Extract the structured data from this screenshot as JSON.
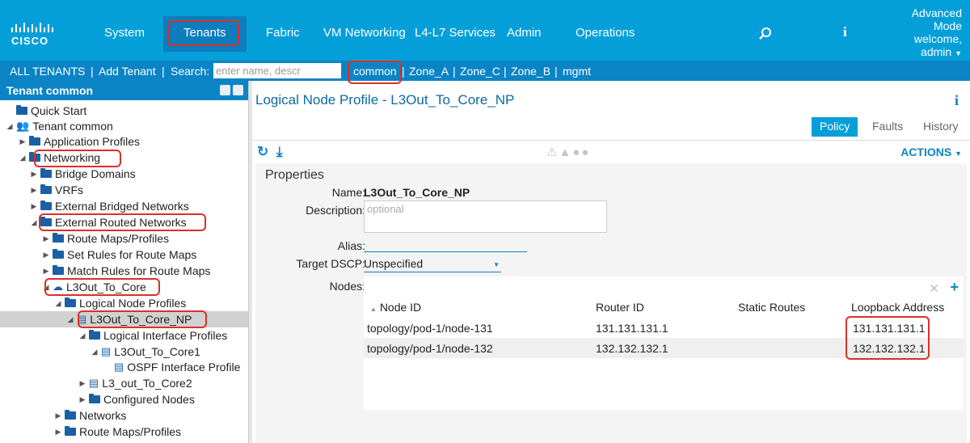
{
  "nav": {
    "items": [
      "System",
      "Tenants",
      "Fabric",
      "VM Networking",
      "L4-L7 Services",
      "Admin",
      "Operations"
    ],
    "mode": "Advanced\nMode",
    "welcome": "welcome,",
    "user": "admin"
  },
  "subnav": {
    "all_tenants": "ALL TENANTS",
    "add_tenant": "Add Tenant",
    "search_label": "Search:",
    "search_placeholder": "enter name, descr",
    "tenants": [
      "common",
      "Zone_A",
      "Zone_C",
      "Zone_B",
      "mgmt"
    ],
    "sep": "|"
  },
  "left": {
    "header": "Tenant common",
    "tree": [
      {
        "label": "Quick Start",
        "icon": "folder"
      },
      {
        "label": "Tenant common",
        "icon": "tenant"
      },
      {
        "label": "Application Profiles",
        "icon": "folder"
      },
      {
        "label": "Networking",
        "icon": "folder"
      },
      {
        "label": "Bridge Domains",
        "icon": "folder"
      },
      {
        "label": "VRFs",
        "icon": "folder"
      },
      {
        "label": "External Bridged Networks",
        "icon": "folder"
      },
      {
        "label": "External Routed Networks",
        "icon": "folder"
      },
      {
        "label": "Route Maps/Profiles",
        "icon": "folder"
      },
      {
        "label": "Set Rules for Route Maps",
        "icon": "folder"
      },
      {
        "label": "Match Rules for Route Maps",
        "icon": "folder"
      },
      {
        "label": "L3Out_To_Core",
        "icon": "cloud"
      },
      {
        "label": "Logical Node Profiles",
        "icon": "folder"
      },
      {
        "label": "L3Out_To_Core_NP",
        "icon": "doc"
      },
      {
        "label": "Logical Interface Profiles",
        "icon": "folder"
      },
      {
        "label": "L3Out_To_Core1",
        "icon": "doc"
      },
      {
        "label": "OSPF Interface Profile",
        "icon": "doc"
      },
      {
        "label": "L3_out_To_Core2",
        "icon": "doc"
      },
      {
        "label": "Configured Nodes",
        "icon": "folder"
      },
      {
        "label": "Networks",
        "icon": "folder"
      },
      {
        "label": "Route Maps/Profiles",
        "icon": "folder"
      }
    ]
  },
  "right": {
    "title": "Logical Node Profile - L3Out_To_Core_NP",
    "tabs": [
      "Policy",
      "Faults",
      "History"
    ],
    "actions": "ACTIONS",
    "properties": {
      "heading": "Properties",
      "name_label": "Name:",
      "name_value": "L3Out_To_Core_NP",
      "description_label": "Description:",
      "description_placeholder": "optional",
      "alias_label": "Alias:",
      "dscp_label": "Target DSCP:",
      "dscp_value": "Unspecified",
      "nodes_label": "Nodes:"
    },
    "nodes_table": {
      "columns": [
        "Node ID",
        "Router ID",
        "Static Routes",
        "Loopback Address"
      ],
      "rows": [
        [
          "topology/pod-1/node-131",
          "131.131.131.1",
          "",
          "131.131.131.1"
        ],
        [
          "topology/pod-1/node-132",
          "132.132.132.1",
          "",
          "132.132.132.1"
        ]
      ]
    }
  },
  "colors": {
    "brand": "#049fd9",
    "subbar": "#0b84c5",
    "highlight": "#d9302a"
  }
}
